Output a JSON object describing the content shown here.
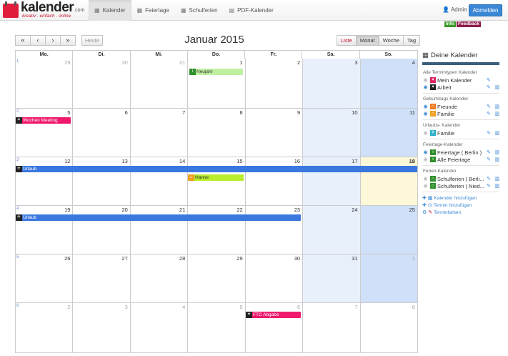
{
  "brand": {
    "name": "kalender",
    "suffix": ".com",
    "tagline": "kreativ . einfach . online"
  },
  "nav": {
    "tabs": [
      {
        "label": "Kalender",
        "icon": "calendar-icon"
      },
      {
        "label": "Feiertage",
        "icon": "calendar-icon"
      },
      {
        "label": "Schulferien",
        "icon": "calendar-icon"
      },
      {
        "label": "PDF-Kalender",
        "icon": "document-icon"
      }
    ],
    "user": "Admin",
    "logout": "Abmelden",
    "info": "Info",
    "feedback": "Feedback"
  },
  "toolbar": {
    "nav_buttons": [
      "«",
      "‹",
      "›",
      "»"
    ],
    "today": "Heute",
    "month_title": "Januar 2015",
    "views": [
      "Liste",
      "Monat",
      "Woche",
      "Tag"
    ],
    "active_view": "Monat"
  },
  "calendar": {
    "weekdays": [
      "Mo.",
      "Di.",
      "Mi.",
      "Do.",
      "Fr.",
      "Sa.",
      "So."
    ],
    "weeks": [
      {
        "week": "1",
        "days": [
          "29",
          "30",
          "31",
          "1",
          "2",
          "3",
          "4"
        ]
      },
      {
        "week": "2",
        "days": [
          "5",
          "6",
          "7",
          "8",
          "9",
          "10",
          "11"
        ]
      },
      {
        "week": "3",
        "days": [
          "12",
          "13",
          "14",
          "15",
          "16",
          "17",
          "18"
        ]
      },
      {
        "week": "4",
        "days": [
          "19",
          "20",
          "21",
          "22",
          "23",
          "24",
          "25"
        ]
      },
      {
        "week": "5",
        "days": [
          "26",
          "27",
          "28",
          "29",
          "30",
          "31",
          "1"
        ]
      },
      {
        "week": "6",
        "days": [
          "2",
          "3",
          "4",
          "5",
          "6",
          "7",
          "8"
        ]
      }
    ],
    "events": {
      "neujahr": "Neujahr",
      "wochen_meeting": "Wochen Meeting",
      "urlaub_1": "Urlaub",
      "hanne": "Hanne",
      "urlaub_2": "Urlaub",
      "ftc_abgabe": "FTC Abgabe"
    }
  },
  "sidebar": {
    "title": "Deine Kalender",
    "groups": [
      {
        "title": "Alle Termintypen Kalender",
        "items": [
          "Mein Kalender",
          "Arbeit"
        ]
      },
      {
        "title": "Geburtstags Kalender",
        "items": [
          "Freunde",
          "Familie"
        ]
      },
      {
        "title": "Urlaubs- Kalender",
        "items": [
          "Familie"
        ]
      },
      {
        "title": "Feiertage-Kalender",
        "items": [
          "Feiertage ( Berlin )",
          "Alle Feiertage"
        ]
      },
      {
        "title": "Ferien-Kalender",
        "items": [
          "Schulferien ( Berli...",
          "Schulferien ( Nied..."
        ]
      }
    ],
    "links": [
      "Kalender hinzufügen",
      "Termin hinzufügen",
      "Terminfarben"
    ]
  },
  "colors": {
    "accent": "#3a87d6",
    "weekend": "#e8f0fb",
    "sunday": "#cfe0f8",
    "today": "#fcf8d8",
    "event_pink": "#f0196e",
    "event_blue": "#3a78e0",
    "event_green": "#bff0a0",
    "event_lime": "#b8ec2c"
  }
}
